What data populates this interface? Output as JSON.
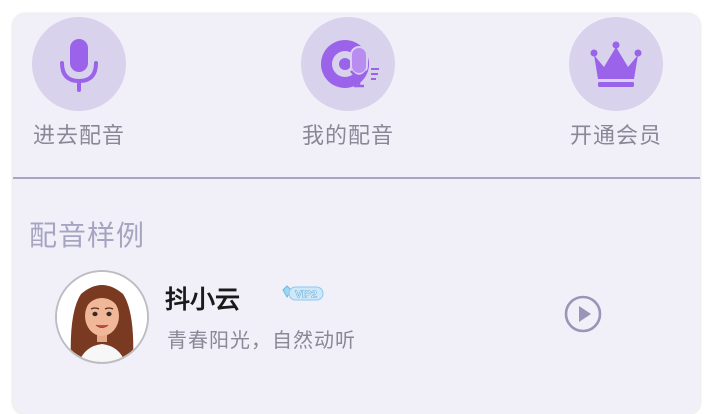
{
  "shortcuts": [
    {
      "label": "进去配音",
      "icon": "microphone-icon"
    },
    {
      "label": "我的配音",
      "icon": "my-dubbing-icon"
    },
    {
      "label": "开通会员",
      "icon": "crown-icon"
    }
  ],
  "section": {
    "title": "配音样例"
  },
  "sample": {
    "name": "抖小云",
    "badge": "VIP2",
    "description": "青春阳光，自然动听"
  },
  "colors": {
    "accent": "#9b63ea",
    "circle": "#d8d2ec",
    "card": "#f1f0f8",
    "label": "#8a8796",
    "section_title": "#a7a4c2",
    "divider": "#a8a5c6"
  }
}
